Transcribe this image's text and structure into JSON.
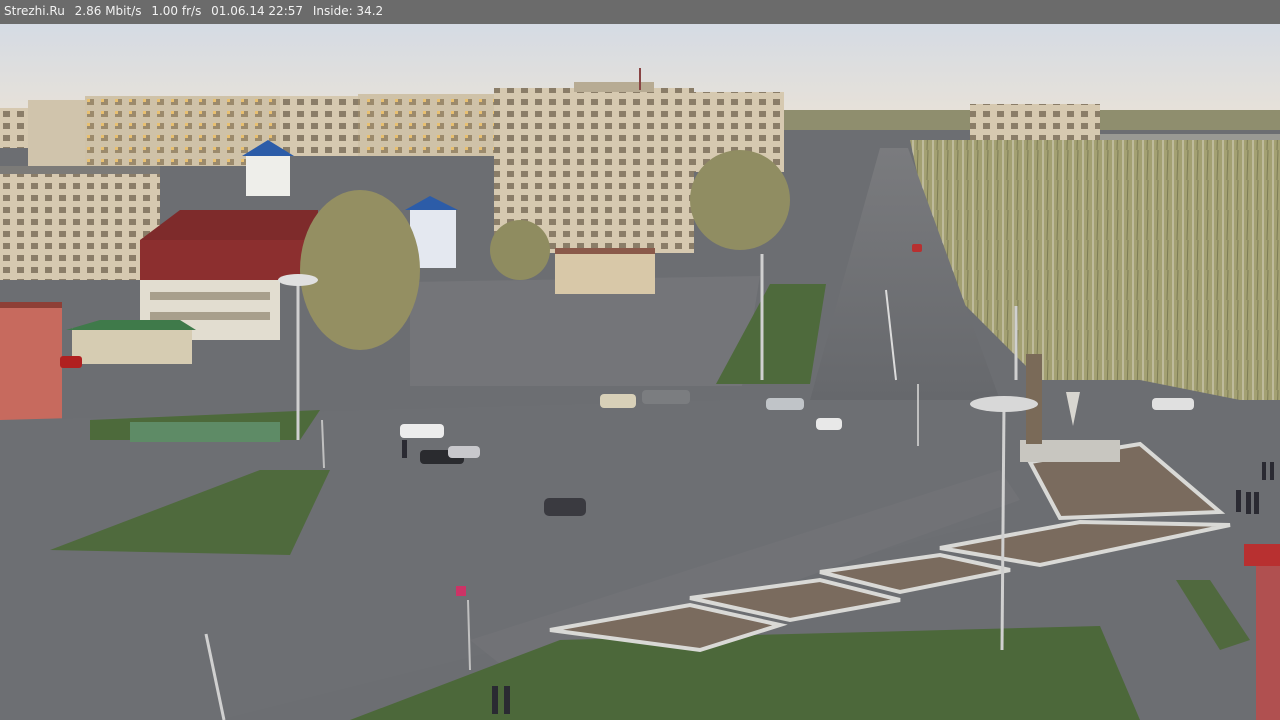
{
  "overlay": {
    "site": "Strezhi.Ru",
    "bitrate": "2.86 Mbit/s",
    "framerate": "1.00 fr/s",
    "datetime": "01.06.14 22:57",
    "inside": "Inside: 34.2"
  },
  "colors": {
    "status_bar": "#6b6b6b",
    "sky_top": "#d9dde4",
    "sky_bottom": "#e6e2dc",
    "asphalt": "#6f7175",
    "grass": "#4f6b3e",
    "trees": "#9a9a6a",
    "building_light": "#d8cdb8",
    "building_red": "#8a2a2a"
  }
}
